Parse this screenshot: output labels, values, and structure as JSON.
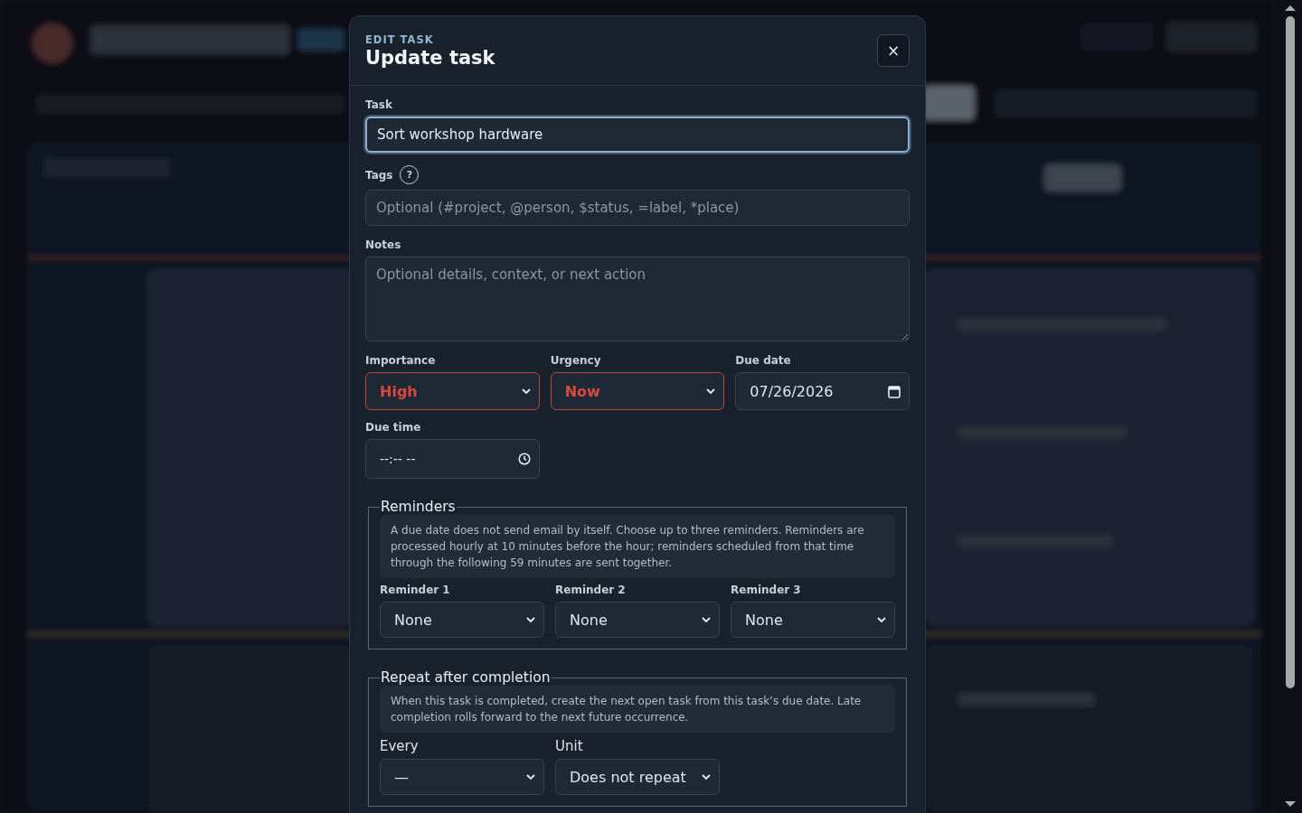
{
  "dialog": {
    "eyebrow": "EDIT TASK",
    "title": "Update task",
    "close": "×"
  },
  "task": {
    "label": "Task",
    "value": "Sort workshop hardware",
    "focused": true
  },
  "tags": {
    "label": "Tags",
    "help": "?",
    "placeholder": "Optional (#project, @person, $status, =label, *place)"
  },
  "notes": {
    "label": "Notes",
    "placeholder": "Optional details, context, or next action"
  },
  "row_fields": [
    {
      "kind": "select",
      "label": "Importance",
      "value": "High",
      "alert": true
    },
    {
      "kind": "select",
      "label": "Urgency",
      "value": "Now",
      "alert": true
    },
    {
      "kind": "date",
      "label": "Due date",
      "value": "07/26/2026",
      "alert": false
    }
  ],
  "due_time": {
    "label": "Due time",
    "value": "--:-- --"
  },
  "reminders": {
    "legend": "Reminders",
    "note": "A due date does not send email by itself. Choose up to three reminders. Reminders are processed hourly at 10 minutes before the hour; reminders scheduled from that time through the following 59 minutes are sent together.",
    "selects": [
      {
        "label": "Reminder 1",
        "value": "None"
      },
      {
        "label": "Reminder 2",
        "value": "None"
      },
      {
        "label": "Reminder 3",
        "value": "None"
      }
    ]
  },
  "repeat": {
    "legend": "Repeat after completion",
    "note": "When this task is completed, create the next open task from this task’s due date. Late completion rolls forward to the next future occurrence.",
    "selects": [
      {
        "label": "Every",
        "value": "—"
      },
      {
        "label": "Unit",
        "value": "Does not repeat"
      }
    ]
  }
}
